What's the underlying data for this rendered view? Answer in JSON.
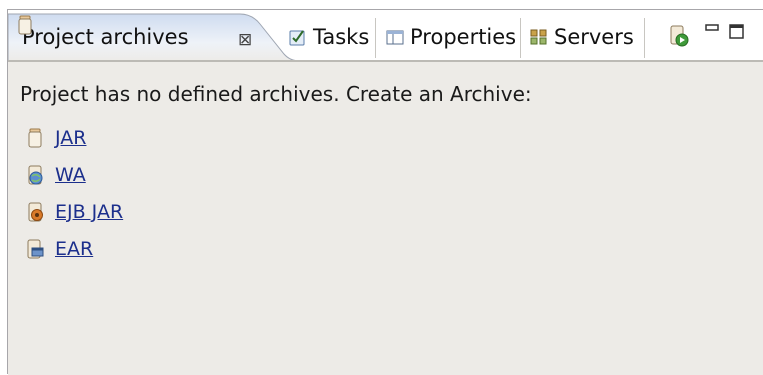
{
  "tabs": [
    {
      "label": "Project archives",
      "icon": "jar-icon",
      "active": true
    },
    {
      "label": "Tasks",
      "icon": "tasks-icon",
      "active": false
    },
    {
      "label": "Properties",
      "icon": "properties-icon",
      "active": false
    },
    {
      "label": "Servers",
      "icon": "servers-icon",
      "active": false
    }
  ],
  "close_glyph": "⊠",
  "content": {
    "message": "Project has no defined archives. Create an Archive:",
    "archive_types": [
      {
        "label": "JAR",
        "icon": "jar-icon"
      },
      {
        "label": "WA",
        "icon": "war-icon"
      },
      {
        "label": "EJB JAR",
        "icon": "ejb-jar-icon"
      },
      {
        "label": "EAR",
        "icon": "ear-icon"
      }
    ]
  },
  "colors": {
    "link": "#1c2f8c",
    "panel_bg": "#edebe7",
    "active_tab_top": "#d9e5f5"
  }
}
